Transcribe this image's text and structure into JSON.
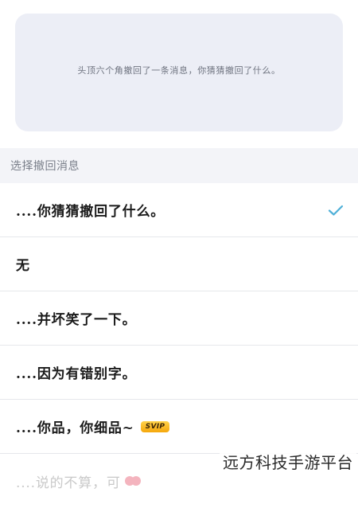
{
  "preview": {
    "text": "头顶六个角撤回了一条消息，你猜猜撤回了什么。"
  },
  "section": {
    "title": "选择撤回消息"
  },
  "options": [
    {
      "label": "....你猜猜撤回了什么。",
      "selected": true
    },
    {
      "label": "无",
      "selected": false
    },
    {
      "label": "....并坏笑了一下。",
      "selected": false
    },
    {
      "label": "....因为有错别字。",
      "selected": false
    },
    {
      "label": "....你品，你细品~",
      "selected": false,
      "badge": "SVIP"
    },
    {
      "label": "....说的不算，可",
      "selected": false,
      "trailing_icon": "heart-emoji-icon"
    }
  ],
  "colors": {
    "check": "#4fb0d8",
    "card_bg": "#eceef6",
    "svip_gradient_top": "#ffd24a",
    "svip_gradient_bottom": "#f5a70c"
  },
  "watermark": {
    "text": "远方科技手游平台"
  }
}
